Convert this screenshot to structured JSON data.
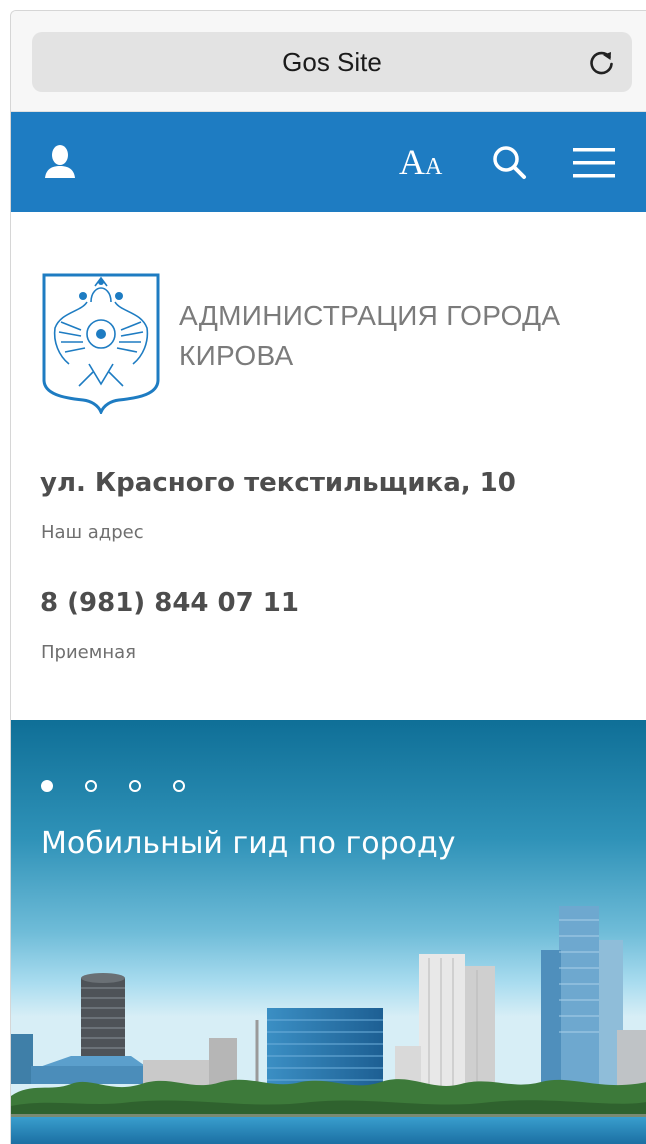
{
  "browser": {
    "title": "Gos Site"
  },
  "header": {
    "font_icon_big": "A",
    "font_icon_small": "A"
  },
  "organization": {
    "name_line1": "АДМИНИСТРАЦИЯ ГОРОДА",
    "name_line2": "КИРОВА",
    "address": "ул. Красного текстильщика, 10",
    "address_caption": "Наш адрес",
    "phone": "8 (981) 844 07 11",
    "phone_caption": "Приемная"
  },
  "hero": {
    "title": "Мобильный гид по городу",
    "slides_total": 4,
    "active_slide": 1
  },
  "colors": {
    "header_blue": "#1e7cc2",
    "text_dark": "#4d4d4d",
    "text_muted": "#7b7b7b"
  }
}
